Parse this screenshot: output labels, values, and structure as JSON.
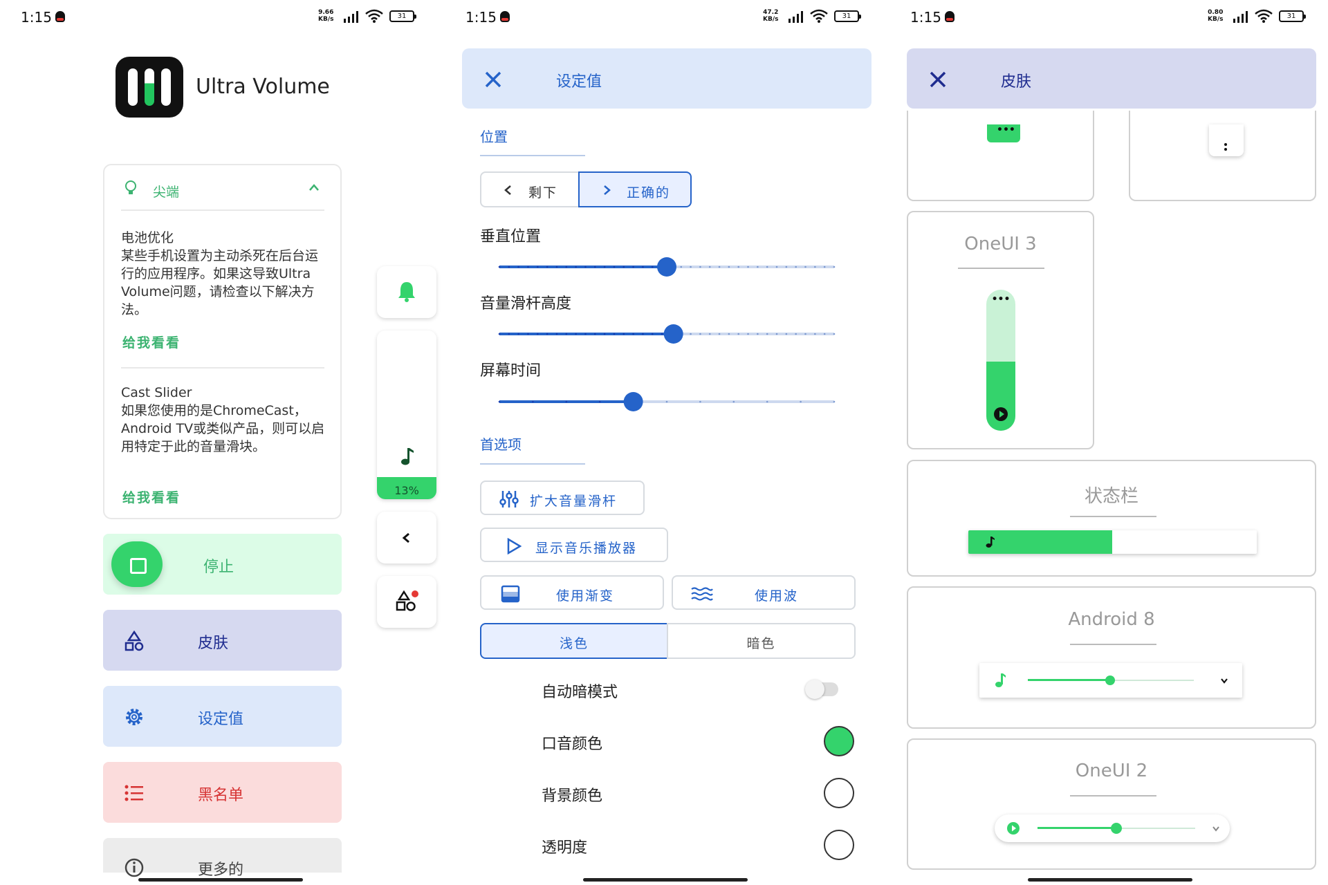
{
  "status_bar": {
    "time": "1:15",
    "panels": [
      {
        "speed_value": "9.66",
        "speed_unit": "KB/s",
        "battery": "31"
      },
      {
        "speed_value": "47.2",
        "speed_unit": "KB/s",
        "battery": "31"
      },
      {
        "speed_value": "0.80",
        "speed_unit": "KB/s",
        "battery": "31"
      }
    ]
  },
  "home": {
    "app_name": "Ultra Volume",
    "tips": {
      "title": "尖端",
      "items": [
        {
          "title": "电池优化",
          "body": "某些手机设置为主动杀死在后台运行的应用程序。如果这导致Ultra Volume问题，请检查以下解决方法。",
          "link": "给我看看"
        },
        {
          "title": "Cast Slider",
          "body": "如果您使用的是ChromeCast，Android TV或类似产品，则可以启用特定于此的音量滑块。",
          "link": "给我看看"
        }
      ]
    },
    "menu": {
      "stop": "停止",
      "skin": "皮肤",
      "settings": "设定值",
      "blacklist": "黑名单",
      "more": "更多的"
    },
    "volume_preview": {
      "percent_label": "13%",
      "percent": 13
    }
  },
  "settings": {
    "title": "设定值",
    "position_section": "位置",
    "left_label": "剩下",
    "right_label": "正确的",
    "vertical_position": {
      "label": "垂直位置",
      "value": 0.5
    },
    "slider_height": {
      "label": "音量滑杆高度",
      "value": 0.52
    },
    "screen_time": {
      "label": "屏幕时间",
      "value": 0.4
    },
    "preferences_section": "首选项",
    "expand_slider": "扩大音量滑杆",
    "show_music_player": "显示音乐播放器",
    "use_gradient": "使用渐变",
    "use_wave": "使用波",
    "theme_light": "浅色",
    "theme_dark": "暗色",
    "auto_dark_mode": "自动暗模式",
    "accent_color": "口音颜色",
    "background_color": "背景颜色",
    "transparency": "透明度",
    "colors": {
      "accent": "#34d36c",
      "primary": "#2563c9"
    }
  },
  "skins": {
    "title": "皮肤",
    "oneui3": "OneUI 3",
    "statusbar": "状态栏",
    "android8": "Android 8",
    "oneui2": "OneUI 2"
  }
}
